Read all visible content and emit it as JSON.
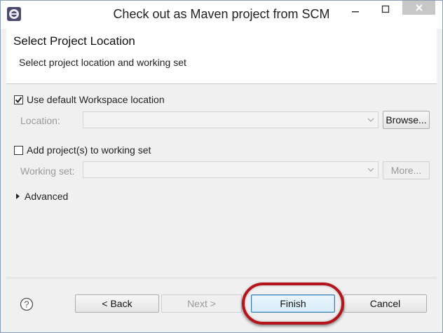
{
  "window": {
    "title": "Check out as Maven project from SCM"
  },
  "header": {
    "title": "Select Project Location",
    "description": "Select project location and working set"
  },
  "workspace": {
    "use_default_label": "Use default Workspace location",
    "use_default_checked": true,
    "location_label": "Location:",
    "location_value": "",
    "browse_label": "Browse..."
  },
  "working_set": {
    "add_label": "Add project(s) to working set",
    "add_checked": false,
    "label": "Working set:",
    "value": "",
    "more_label": "More..."
  },
  "advanced": {
    "label": "Advanced"
  },
  "footer": {
    "help_icon": "question-icon",
    "back_label": "< Back",
    "next_label": "Next >",
    "finish_label": "Finish",
    "cancel_label": "Cancel"
  },
  "colors": {
    "highlight": "#b4141a",
    "default_button": "#3c7fb1"
  }
}
